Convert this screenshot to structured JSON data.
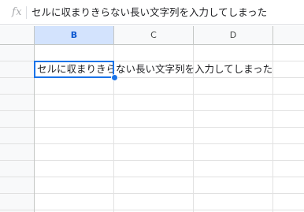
{
  "formula_bar": {
    "fx_label": "fx",
    "content": "セルに収まりきらない長い文字列を入力してしまった"
  },
  "columns": {
    "b": "B",
    "c": "C",
    "d": "D",
    "e": ""
  },
  "active_cell": {
    "column": "B",
    "value": "セルに収まりきらない長い文字列を入力してしまった"
  },
  "colors": {
    "selection": "#1a73e8",
    "selected_header_bg": "#d3e3fd",
    "gridline": "#e1e1e1"
  }
}
